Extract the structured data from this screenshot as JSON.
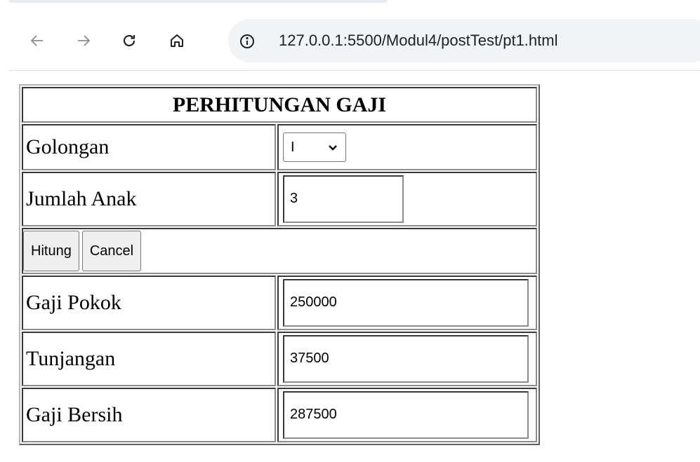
{
  "browser": {
    "url": "127.0.0.1:5500/Modul4/postTest/pt1.html"
  },
  "form": {
    "title": "PERHITUNGAN GAJI",
    "golongan_label": "Golongan",
    "golongan_value": "I",
    "jumlah_anak_label": "Jumlah Anak",
    "jumlah_anak_value": "3",
    "hitung_label": "Hitung",
    "cancel_label": "Cancel",
    "gaji_pokok_label": "Gaji Pokok",
    "gaji_pokok_value": "250000",
    "tunjangan_label": "Tunjangan",
    "tunjangan_value": "37500",
    "gaji_bersih_label": "Gaji Bersih",
    "gaji_bersih_value": "287500"
  }
}
